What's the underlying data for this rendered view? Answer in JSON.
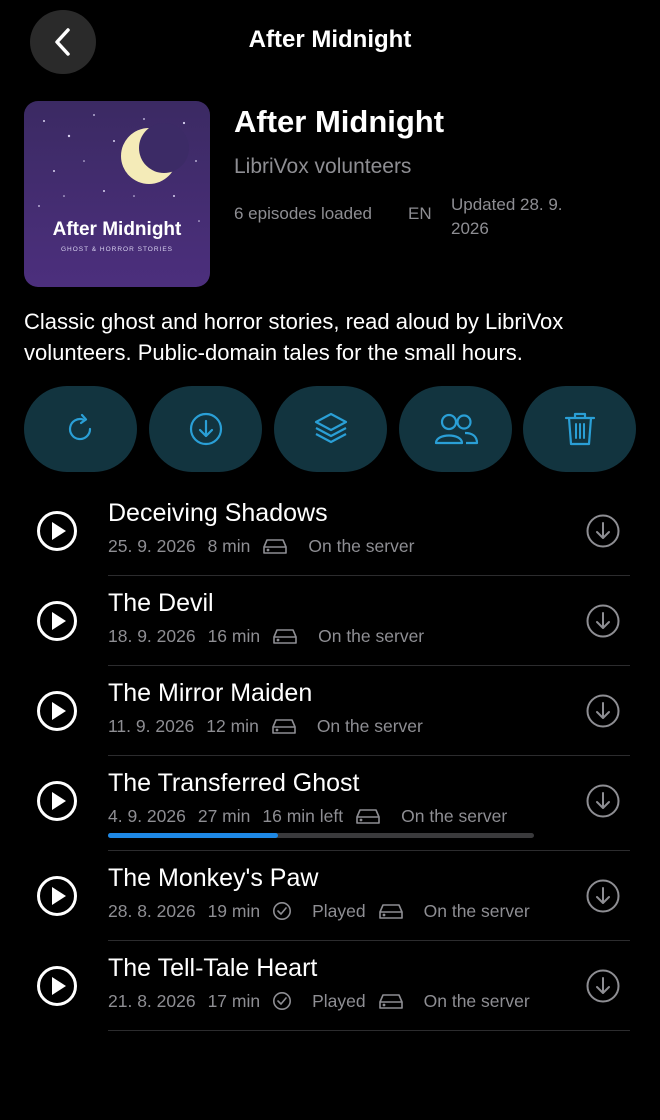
{
  "header": {
    "title": "After Midnight",
    "back_icon": "chevron-left-icon"
  },
  "podcast": {
    "cover_title": "After Midnight",
    "cover_subtitle": "GHOST & HORROR STORIES",
    "title": "After Midnight",
    "author": "LibriVox volunteers",
    "episodes_loaded": "6 episodes loaded",
    "language": "EN",
    "updated": "Updated 28. 9. 2026",
    "description": "Classic ghost and horror stories, read aloud by LibriVox volunteers. Public-domain tales for the small hours."
  },
  "actions": [
    {
      "icon": "refresh-icon"
    },
    {
      "icon": "download-icon"
    },
    {
      "icon": "layers-icon"
    },
    {
      "icon": "people-icon"
    },
    {
      "icon": "trash-icon"
    }
  ],
  "colors": {
    "accent": "#1e88e5",
    "action_bg": "#12343f",
    "icon": "#2a9fd6",
    "muted": "#8e8e93"
  },
  "episodes": [
    {
      "title": "Deceiving Shadows",
      "date": "25. 9. 2026",
      "duration": "8 min",
      "status": "On the server"
    },
    {
      "title": "The Devil",
      "date": "18. 9. 2026",
      "duration": "16 min",
      "status": "On the server"
    },
    {
      "title": "The Mirror Maiden",
      "date": "11. 9. 2026",
      "duration": "12 min",
      "status": "On the server"
    },
    {
      "title": "The Transferred Ghost",
      "date": "4. 9. 2026",
      "duration": "27 min",
      "remaining": "16 min left",
      "status": "On the server",
      "progress": 0.4
    },
    {
      "title": "The Monkey's Paw",
      "date": "28. 8. 2026",
      "duration": "19 min",
      "played": "Played",
      "status": "On the server"
    },
    {
      "title": "The Tell-Tale Heart",
      "date": "21. 8. 2026",
      "duration": "17 min",
      "played": "Played",
      "status": "On the server"
    }
  ]
}
